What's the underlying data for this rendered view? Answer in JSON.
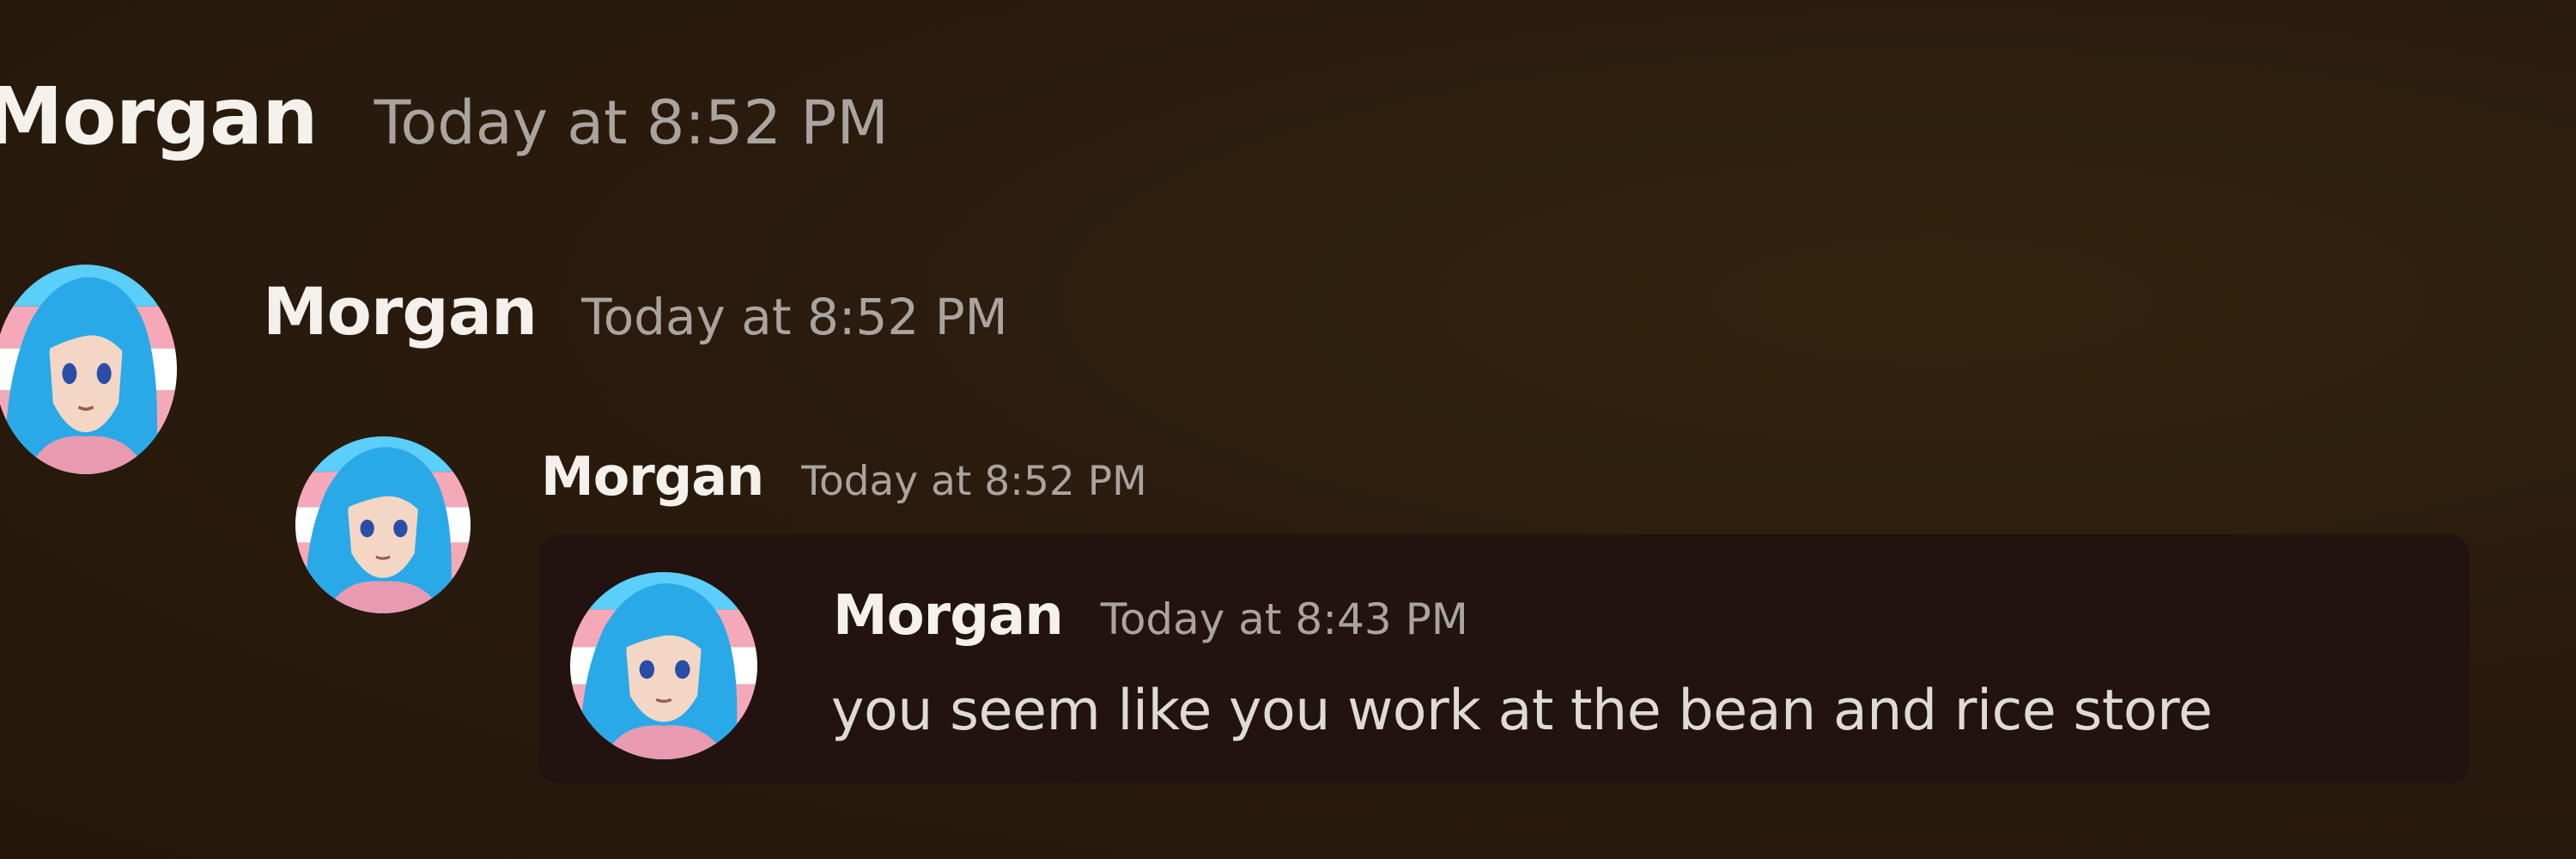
{
  "messages": [
    {
      "author": "Morgan",
      "timestamp": "Today at 8:52 PM"
    },
    {
      "author": "Morgan",
      "timestamp": "Today at 8:52 PM"
    },
    {
      "author": "Morgan",
      "timestamp": "Today at 8:52 PM"
    },
    {
      "author": "Morgan",
      "timestamp": "Today at 8:43 PM",
      "text": "you seem like you work at the bean and rice store"
    }
  ],
  "avatar": {
    "icon": "anime-girl-avatar-icon",
    "flag_colors": [
      "#5bcefa",
      "#f5a9b8",
      "#ffffff"
    ],
    "hair_color": "#2aa9e8"
  },
  "colors": {
    "background": "#2a1b0d",
    "embed_background": "#221210",
    "name": "#f4f1ec",
    "timestamp": "#a9a4a0",
    "message_text": "#dedad6"
  }
}
